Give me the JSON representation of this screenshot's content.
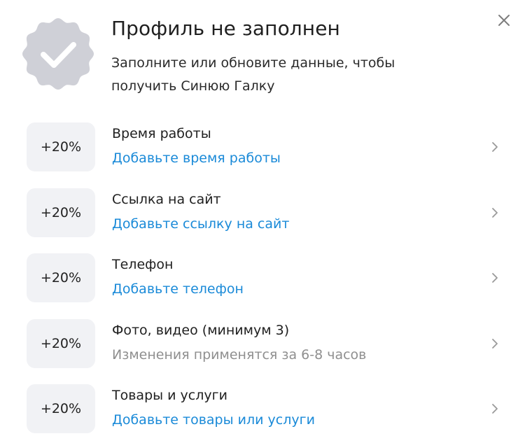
{
  "header": {
    "title": "Профиль не заполнен",
    "subtitle": "Заполните или обновите данные, чтобы получить Синюю Галку"
  },
  "icons": {
    "badge": "verified-badge-icon",
    "close": "close-icon",
    "chevron": "chevron-right-icon"
  },
  "colors": {
    "link": "#1a8ad8",
    "muted": "#8f8f8f",
    "badge": "#cfd0d7",
    "tile": "#f1f2f5"
  },
  "items": [
    {
      "percent": "+20%",
      "title": "Время работы",
      "subtitle": "Добавьте время работы",
      "subtitle_style": "link"
    },
    {
      "percent": "+20%",
      "title": "Ссылка на сайт",
      "subtitle": "Добавьте ссылку на сайт",
      "subtitle_style": "link"
    },
    {
      "percent": "+20%",
      "title": "Телефон",
      "subtitle": "Добавьте телефон",
      "subtitle_style": "link"
    },
    {
      "percent": "+20%",
      "title": "Фото, видео (минимум 3)",
      "subtitle": "Изменения применятся за 6-8 часов",
      "subtitle_style": "muted"
    },
    {
      "percent": "+20%",
      "title": "Товары и услуги",
      "subtitle": "Добавьте товары или услуги",
      "subtitle_style": "link"
    }
  ]
}
